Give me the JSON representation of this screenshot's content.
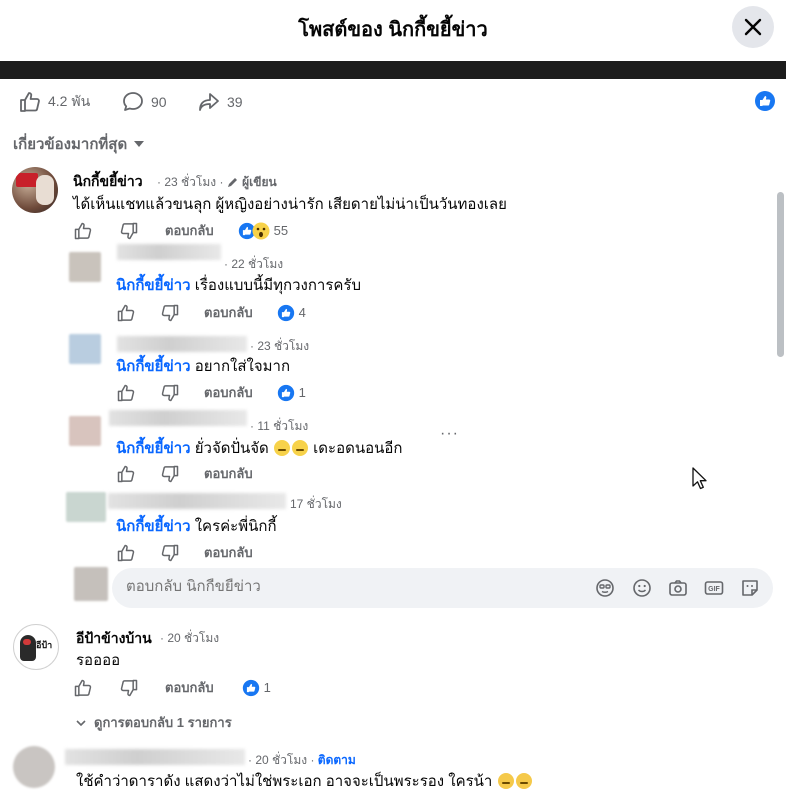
{
  "header": {
    "title": "โพสต์ของ นิกกี้ขยี้ข่าว"
  },
  "stats": {
    "likes": "4.2 พัน",
    "comments": "90",
    "shares": "39"
  },
  "sort_label": "เกี่ยวข้องมากที่สุด",
  "reply_label": "ตอบกลับ",
  "comments": [
    {
      "name": "นิกกี้ขยี้ข่าว",
      "time": "· 23 ชั่วโมง ·",
      "badge": "ผู้เขียน",
      "text": "ได้เห็นแชทแล้วขนลุก ผู้หญิงอย่างน่ารัก เสียดายไม่น่าเป็นวันทองเลย",
      "reactions": "55"
    },
    {
      "time": "· 22 ชั่วโมง",
      "tag": "นิกกี้ขยี้ข่าว",
      "text": "เรื่องแบบนี้มีทุกวงการครับ",
      "reactions": "4"
    },
    {
      "time": "· 23 ชั่วโมง",
      "tag": "นิกกี้ขยี้ข่าว",
      "text": "อยากใส่ใจมาก",
      "reactions": "1"
    },
    {
      "time": "· 11 ชั่วโมง",
      "tag": "นิกกี้ขยี้ข่าว",
      "text": "ยั่วจัดปั่นจัด",
      "text_after": "เดะอดนอนอีก"
    },
    {
      "time": "17 ชั่วโมง",
      "tag": "นิกกี้ขยี้ข่าว",
      "text": "ใครค่ะพี่นิกกี้"
    },
    {
      "name": "อีป้าข้างบ้าน",
      "time": "· 20 ชั่วโมง",
      "text": "รออออ",
      "reactions": "1",
      "avatar_text": "อีป้า"
    },
    {
      "time": "· 20 ชั่วโมง ·",
      "follow": "ติดตาม",
      "text": "ใช้คำว่าดาราดัง แสดงว่าไม่ใช่พระเอก อาจจะเป็นพระรอง ใครน้า"
    }
  ],
  "reply_box": {
    "placeholder": "ตอบกลับ นิกกี้ขยี้ข่าว"
  },
  "view_replies": "ดูการตอบกลับ 1 รายการ",
  "colors": {
    "accent": "#0866ff",
    "muted": "#65676b",
    "bg_input": "#f0f2f5"
  },
  "icons": [
    "close-icon",
    "like-icon",
    "comment-icon",
    "share-icon",
    "dislike-icon",
    "pencil-icon",
    "caret-down-icon",
    "sticker-icon",
    "emoji-icon",
    "camera-icon",
    "gif-icon",
    "avatar-sticker-icon",
    "cursor-icon"
  ]
}
